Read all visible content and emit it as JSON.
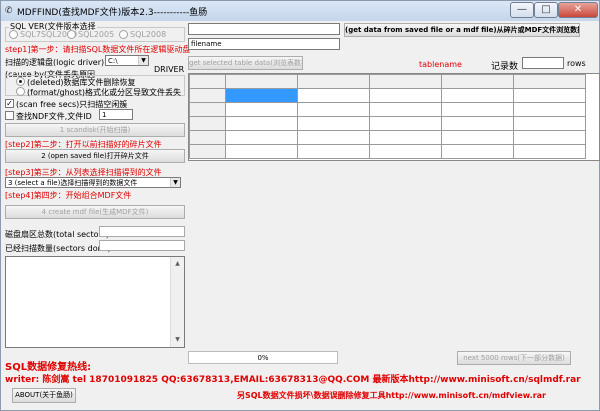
{
  "window": {
    "title": "MDFFIND(查找MDF文件)版本2.3-----------鱼肠",
    "min_glyph": "—",
    "max_glyph": "□",
    "close_glyph": "✕"
  },
  "sql_version": {
    "group_label": "SQL VER(文件版本选择",
    "options": [
      "SQL7SQL2000",
      "SQL2005",
      "SQL2008"
    ],
    "selected": "SQL7SQL2000"
  },
  "step1": {
    "label": "step1]第一步：请扫描SQL数据文件所在逻辑驱动盘",
    "drive_label": "扫描的逻辑盘(logic driver)",
    "drive_value": "C:\\",
    "driver_tag": "DRIVER"
  },
  "cause": {
    "group_label": "(cause by(文件丢失原因",
    "options": [
      "(deleted)数据库文件删除恢复",
      "(format/ghost)格式化或分区导致文件丢失"
    ],
    "selected": "(deleted)数据库文件删除恢复"
  },
  "options": {
    "scan_free_label": "(scan free secs)只扫描空闲簇",
    "scan_free_checked": true,
    "find_ndf_label": "查找NDF文件,文件ID",
    "find_ndf_checked": false,
    "file_id_value": "1"
  },
  "buttons": {
    "scandisk": "1 scandisk(开始扫描)",
    "open_saved": "2 (open saved file)打开碎片文件",
    "create_mdf": "4 create mdf file(生成MDF文件)",
    "get_selected": "get selected table data(浏览表数据)",
    "get_data": "(get data from saved file or a mdf file)从碎片或MDF文件浏览数据",
    "next_5000": "next 5000 rows(下一部分数据)",
    "about": "ABOUT(关于鱼肠)"
  },
  "step2_label": "[step2]第二步：打开以前扫描好的碎片文件",
  "step3": {
    "label": "[step3]第三步：从列表选择扫描得到的文件",
    "select_value": "3 (select a file)选择扫描得到的数据文件"
  },
  "step4_label": "[step4]第四步：开始组合MDF文件",
  "sectors": {
    "total_label": "磁盘扇区总数(total sectors)",
    "done_label": "已经扫描数量(sectors done)",
    "total_value": "",
    "done_value": ""
  },
  "right_panel": {
    "path_value": "",
    "filename_value": "filename",
    "tablename_label": "tablename",
    "record_count_label": "记录数",
    "record_count_value": "",
    "rows_label": "rows"
  },
  "progress": {
    "text": "0%",
    "fraction": 0.0
  },
  "footer": {
    "hotline": "SQL数据修复热线:",
    "writer_line": "writer: 陈剑嵩 tel 18701091825 QQ:63678313,EMAIL:63678313@QQ.COM 最新版本http://www.minisoft.cn/sqlmdf.rar",
    "other_tool": "另SQL数据文件损坏\\数据误删除修复工具http://www.minisoft.cn/mdfview.rar"
  },
  "colors": {
    "accent_red": "#e00000",
    "selected_cell": "#3399ff"
  }
}
